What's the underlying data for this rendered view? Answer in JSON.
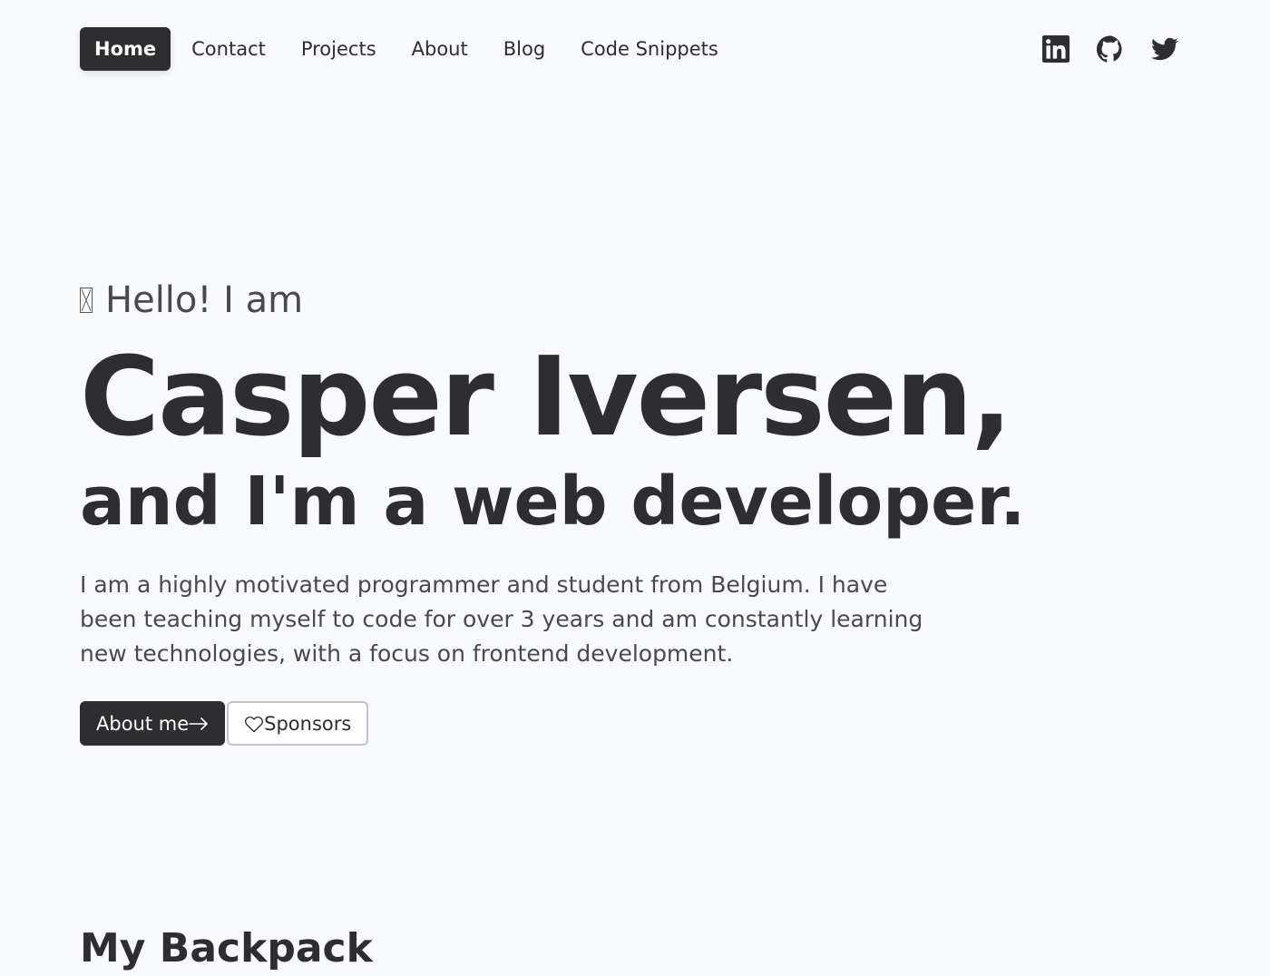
{
  "nav": {
    "items": [
      {
        "label": "Home",
        "active": true
      },
      {
        "label": "Contact"
      },
      {
        "label": "Projects"
      },
      {
        "label": "About"
      },
      {
        "label": "Blog"
      },
      {
        "label": "Code Snippets"
      }
    ],
    "socials": [
      "linkedin-icon",
      "github-icon",
      "twitter-icon"
    ]
  },
  "hero": {
    "greeting_icon": "waving-hand-icon",
    "greeting": "Hello! I am",
    "name": "Casper Iversen,",
    "subtitle": "and I'm a web developer.",
    "description": "I am a highly motivated programmer and student from Belgium. I have been teaching myself to code for over 3 years and am constantly learning new technologies, with a focus on frontend development.",
    "buttons": {
      "about_label": "About me",
      "about_icon": "arrow-right-icon",
      "sponsors_label": "Sponsors",
      "sponsors_icon": "heart-icon"
    }
  },
  "section": {
    "title": "My Backpack"
  },
  "colors": {
    "background": "#f9fafc",
    "text": "#2e2d30",
    "muted": "#4a494d"
  }
}
